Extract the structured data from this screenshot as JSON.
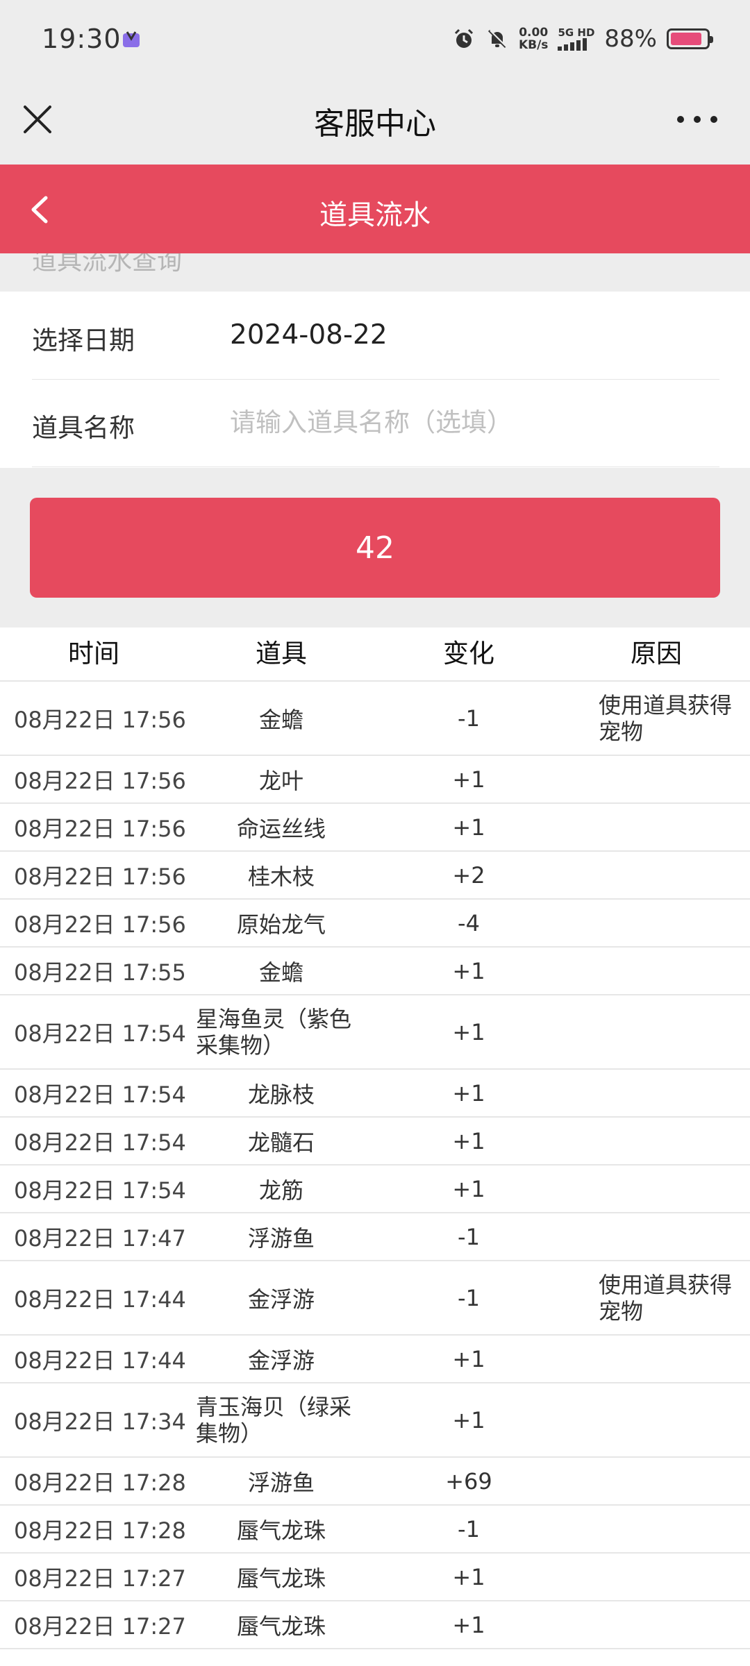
{
  "status_bar": {
    "time": "19:30",
    "net_speed_value": "0.00",
    "net_speed_unit": "KB/s",
    "network": "5G HD",
    "battery_percent": "88%",
    "battery_level": 0.88
  },
  "title_bar": {
    "title": "客服中心"
  },
  "page_header": {
    "title": "道具流水"
  },
  "section": {
    "label": "道具流水查询"
  },
  "form": {
    "date_label": "选择日期",
    "date_value": "2024-08-22",
    "item_label": "道具名称",
    "item_placeholder": "请输入道具名称（选填）"
  },
  "query_button": {
    "label": "42"
  },
  "table": {
    "headers": [
      "时间",
      "道具",
      "变化",
      "原因"
    ],
    "rows": [
      {
        "time": "08月22日 17:56",
        "item": "金蟾",
        "change": "-1",
        "reason": "使用道具获得宠物"
      },
      {
        "time": "08月22日 17:56",
        "item": "龙叶",
        "change": "+1",
        "reason": ""
      },
      {
        "time": "08月22日 17:56",
        "item": "命运丝线",
        "change": "+1",
        "reason": ""
      },
      {
        "time": "08月22日 17:56",
        "item": "桂木枝",
        "change": "+2",
        "reason": ""
      },
      {
        "time": "08月22日 17:56",
        "item": "原始龙气",
        "change": "-4",
        "reason": ""
      },
      {
        "time": "08月22日 17:55",
        "item": "金蟾",
        "change": "+1",
        "reason": ""
      },
      {
        "time": "08月22日 17:54",
        "item": "星海鱼灵（紫色采集物）",
        "change": "+1",
        "reason": ""
      },
      {
        "time": "08月22日 17:54",
        "item": "龙脉枝",
        "change": "+1",
        "reason": ""
      },
      {
        "time": "08月22日 17:54",
        "item": "龙髓石",
        "change": "+1",
        "reason": ""
      },
      {
        "time": "08月22日 17:54",
        "item": "龙筋",
        "change": "+1",
        "reason": ""
      },
      {
        "time": "08月22日 17:47",
        "item": "浮游鱼",
        "change": "-1",
        "reason": ""
      },
      {
        "time": "08月22日 17:44",
        "item": "金浮游",
        "change": "-1",
        "reason": "使用道具获得宠物"
      },
      {
        "time": "08月22日 17:44",
        "item": "金浮游",
        "change": "+1",
        "reason": ""
      },
      {
        "time": "08月22日 17:34",
        "item": "青玉海贝（绿采集物）",
        "change": "+1",
        "reason": ""
      },
      {
        "time": "08月22日 17:28",
        "item": "浮游鱼",
        "change": "+69",
        "reason": ""
      },
      {
        "time": "08月22日 17:28",
        "item": "蜃气龙珠",
        "change": "-1",
        "reason": ""
      },
      {
        "time": "08月22日 17:27",
        "item": "蜃气龙珠",
        "change": "+1",
        "reason": ""
      },
      {
        "time": "08月22日 17:27",
        "item": "蜃气龙珠",
        "change": "+1",
        "reason": ""
      }
    ]
  }
}
